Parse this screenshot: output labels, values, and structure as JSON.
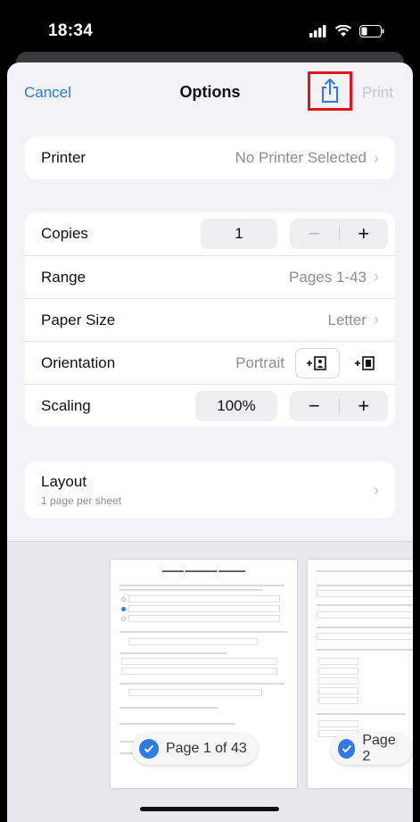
{
  "status": {
    "time": "18:34"
  },
  "nav": {
    "cancel": "Cancel",
    "title": "Options",
    "print": "Print"
  },
  "printer": {
    "label": "Printer",
    "value": "No Printer Selected"
  },
  "copies": {
    "label": "Copies",
    "value": "1",
    "minus": "−",
    "plus": "+"
  },
  "range": {
    "label": "Range",
    "value": "Pages 1-43"
  },
  "paper_size": {
    "label": "Paper Size",
    "value": "Letter"
  },
  "orientation": {
    "label": "Orientation",
    "value": "Portrait"
  },
  "scaling": {
    "label": "Scaling",
    "value": "100%",
    "minus": "−",
    "plus": "+"
  },
  "layout": {
    "label": "Layout",
    "subtitle": "1 page per sheet"
  },
  "preview": {
    "pages": [
      {
        "badge": "Page 1 of 43",
        "selected": true
      },
      {
        "badge": "Page 2",
        "selected": true
      }
    ]
  },
  "colors": {
    "accent": "#2f7ae5",
    "highlight_box": "#e0161a"
  },
  "icons": [
    "share-icon",
    "chevron-right-icon",
    "portrait-orientation-icon",
    "landscape-orientation-icon",
    "checkmark-icon",
    "signal-icon",
    "wifi-icon",
    "battery-icon"
  ]
}
